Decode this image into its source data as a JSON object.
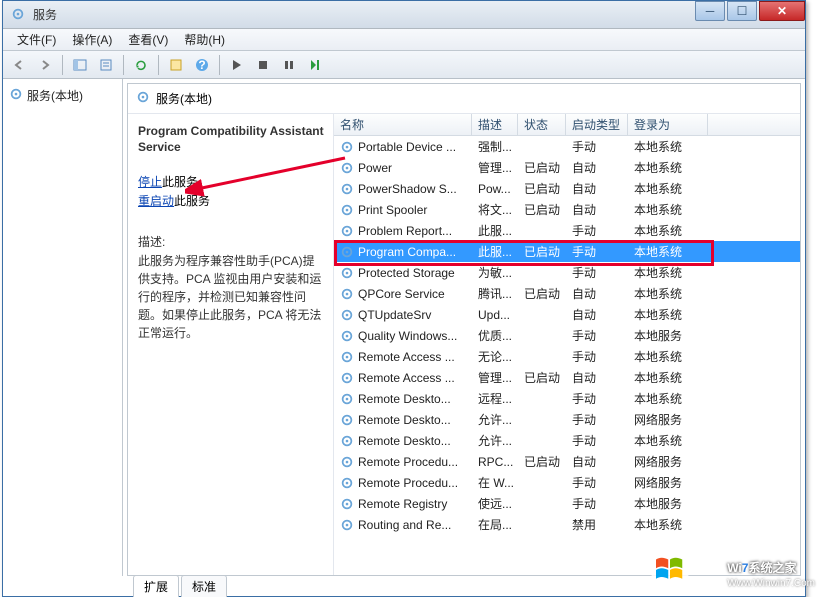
{
  "window": {
    "title": "服务"
  },
  "menus": [
    {
      "label": "文件(F)"
    },
    {
      "label": "操作(A)"
    },
    {
      "label": "查看(V)"
    },
    {
      "label": "帮助(H)"
    }
  ],
  "tree": {
    "root_label": "服务(本地)"
  },
  "right_header": {
    "label": "服务(本地)"
  },
  "detail": {
    "title": "Program Compatibility Assistant Service",
    "stop_link": "停止",
    "stop_suffix": "此服务",
    "restart_link": "重启动",
    "restart_suffix": "此服务",
    "desc_label": "描述:",
    "desc_text": "此服务为程序兼容性助手(PCA)提供支持。PCA 监视由用户安装和运行的程序，并检测已知兼容性问题。如果停止此服务，PCA 将无法正常运行。"
  },
  "columns": {
    "name": "名称",
    "desc": "描述",
    "status": "状态",
    "start": "启动类型",
    "logon": "登录为"
  },
  "rows": [
    {
      "name": "Portable Device ...",
      "desc": "强制...",
      "status": "",
      "start": "手动",
      "logon": "本地系统"
    },
    {
      "name": "Power",
      "desc": "管理...",
      "status": "已启动",
      "start": "自动",
      "logon": "本地系统"
    },
    {
      "name": "PowerShadow S...",
      "desc": "Pow...",
      "status": "已启动",
      "start": "自动",
      "logon": "本地系统"
    },
    {
      "name": "Print Spooler",
      "desc": "将文...",
      "status": "已启动",
      "start": "自动",
      "logon": "本地系统"
    },
    {
      "name": "Problem Report...",
      "desc": "此服...",
      "status": "",
      "start": "手动",
      "logon": "本地系统"
    },
    {
      "name": "Program Compa...",
      "desc": "此服...",
      "status": "已启动",
      "start": "手动",
      "logon": "本地系统",
      "selected": true
    },
    {
      "name": "Protected Storage",
      "desc": "为敏...",
      "status": "",
      "start": "手动",
      "logon": "本地系统"
    },
    {
      "name": "QPCore Service",
      "desc": "腾讯...",
      "status": "已启动",
      "start": "自动",
      "logon": "本地系统"
    },
    {
      "name": "QTUpdateSrv",
      "desc": "Upd...",
      "status": "",
      "start": "自动",
      "logon": "本地系统"
    },
    {
      "name": "Quality Windows...",
      "desc": "优质...",
      "status": "",
      "start": "手动",
      "logon": "本地服务"
    },
    {
      "name": "Remote Access ...",
      "desc": "无论...",
      "status": "",
      "start": "手动",
      "logon": "本地系统"
    },
    {
      "name": "Remote Access ...",
      "desc": "管理...",
      "status": "已启动",
      "start": "自动",
      "logon": "本地系统"
    },
    {
      "name": "Remote Deskto...",
      "desc": "远程...",
      "status": "",
      "start": "手动",
      "logon": "本地系统"
    },
    {
      "name": "Remote Deskto...",
      "desc": "允许...",
      "status": "",
      "start": "手动",
      "logon": "网络服务"
    },
    {
      "name": "Remote Deskto...",
      "desc": "允许...",
      "status": "",
      "start": "手动",
      "logon": "本地系统"
    },
    {
      "name": "Remote Procedu...",
      "desc": "RPC...",
      "status": "已启动",
      "start": "自动",
      "logon": "网络服务"
    },
    {
      "name": "Remote Procedu...",
      "desc": "在 W...",
      "status": "",
      "start": "手动",
      "logon": "网络服务"
    },
    {
      "name": "Remote Registry",
      "desc": "使远...",
      "status": "",
      "start": "手动",
      "logon": "本地服务"
    },
    {
      "name": "Routing and Re...",
      "desc": "在局...",
      "status": "",
      "start": "禁用",
      "logon": "本地系统"
    }
  ],
  "tabs": {
    "extended": "扩展",
    "standard": "标准"
  },
  "watermark": {
    "brand": "Wi",
    "brand2": "7",
    "suffix": "系统之家",
    "url": "Www.Winwin7.Com"
  }
}
